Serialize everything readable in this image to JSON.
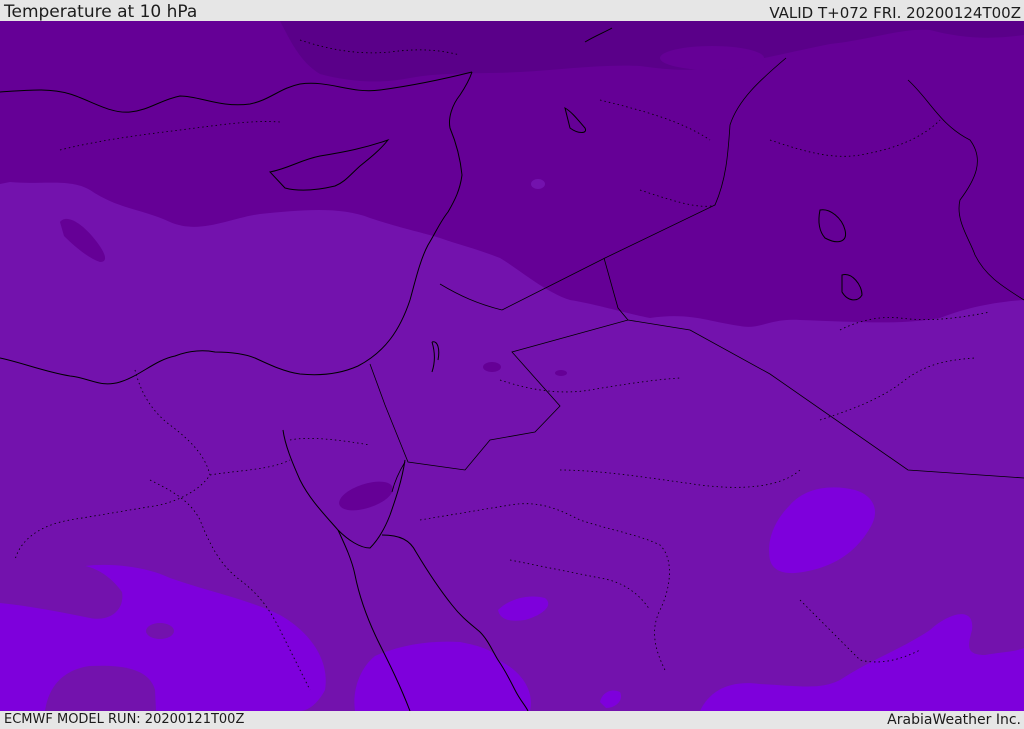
{
  "header": {
    "title": "Temperature at 10 hPa",
    "valid": "VALID T+072 FRI. 20200124T00Z"
  },
  "footer": {
    "model_run": "ECMWF MODEL RUN: 20200121T00Z",
    "credit": "ArabiaWeather Inc."
  },
  "map": {
    "field": "temperature",
    "colors": {
      "coldest": "#5a0089",
      "cold": "#650096",
      "mid": "#7312ad",
      "warm": "#7e00dc",
      "coast": "#000000"
    }
  }
}
